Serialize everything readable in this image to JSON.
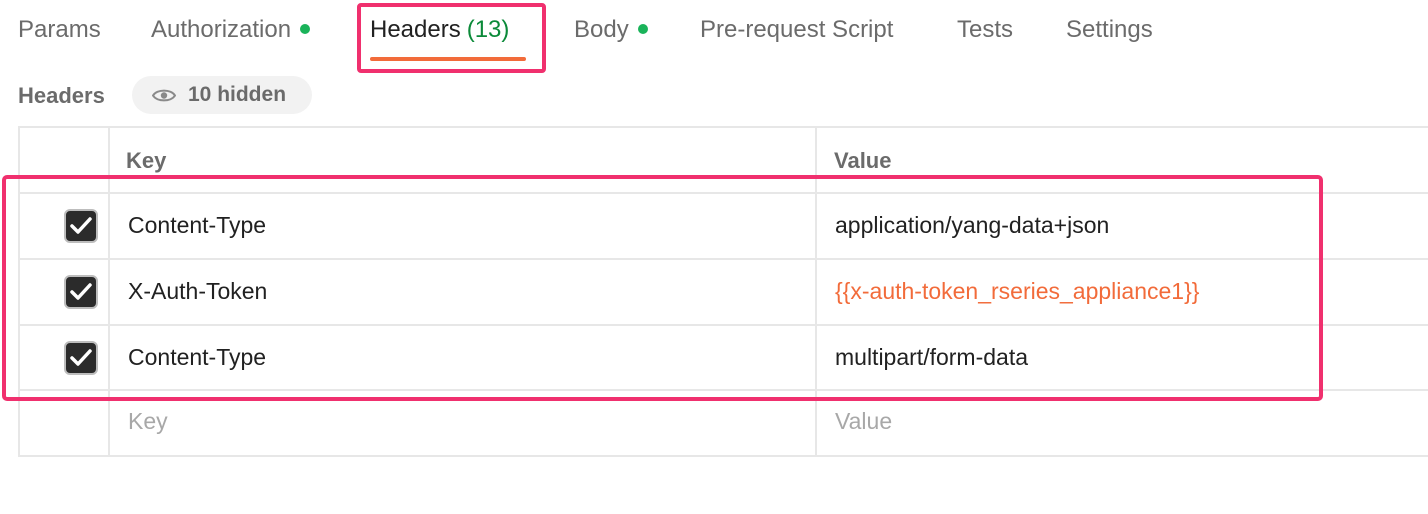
{
  "tabs": [
    {
      "label": "Params"
    },
    {
      "label": "Authorization",
      "dot": true
    },
    {
      "label": "Headers",
      "count": "(13)",
      "active": true
    },
    {
      "label": "Body",
      "dot": true
    },
    {
      "label": "Pre-request Script"
    },
    {
      "label": "Tests"
    },
    {
      "label": "Settings"
    }
  ],
  "headers_section": {
    "title": "Headers",
    "hidden_label": "10 hidden",
    "hidden_icon": "eye-icon"
  },
  "table": {
    "columns": {
      "key": "Key",
      "value": "Value"
    },
    "rows": [
      {
        "checked": true,
        "key": "Content-Type",
        "value": "application/yang-data+json"
      },
      {
        "checked": true,
        "key": "X-Auth-Token",
        "value": "{{x-auth-token_rseries_appliance1}}",
        "value_is_variable": true
      },
      {
        "checked": true,
        "key": "Content-Type",
        "value": "multipart/form-data"
      }
    ],
    "new_row": {
      "key_placeholder": "Key",
      "value_placeholder": "Value"
    }
  },
  "colors": {
    "accent": "#f26b3a",
    "highlight": "#f0306e",
    "status_dot": "#1ab35a",
    "count": "#0b8a39"
  }
}
